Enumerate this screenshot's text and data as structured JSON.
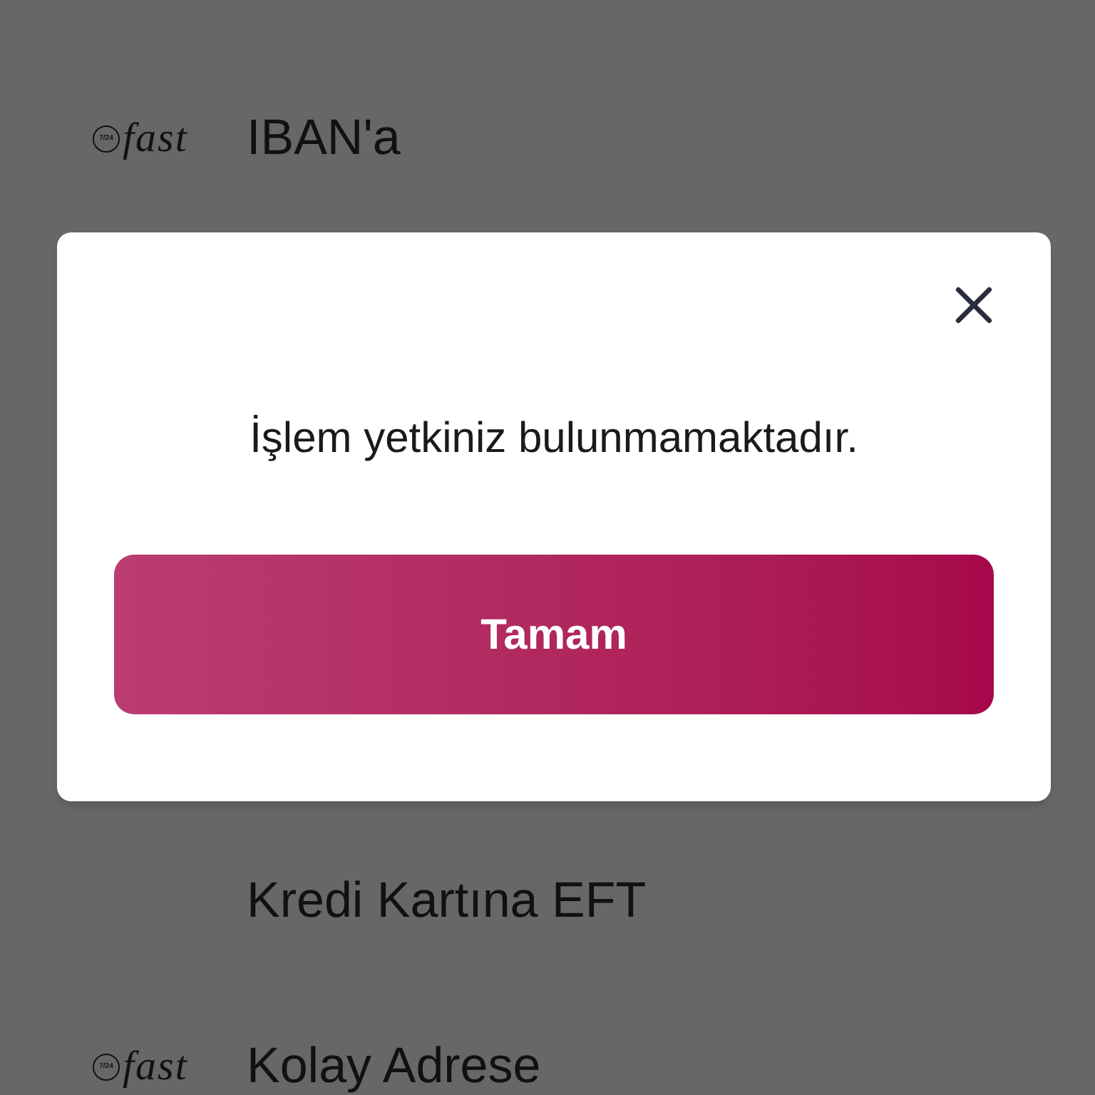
{
  "background_list": {
    "items": [
      {
        "label": "IBAN'a",
        "logo": {
          "badge": "7/24",
          "wordmark": "fast"
        }
      },
      {
        "label": "Kredi Kartına EFT"
      },
      {
        "label": "Kolay Adrese",
        "logo": {
          "badge": "7/24",
          "wordmark": "fast"
        }
      }
    ]
  },
  "dialog": {
    "message": "İşlem yetkiniz bulunmamaktadır.",
    "buttons": [
      "Tamam"
    ]
  }
}
